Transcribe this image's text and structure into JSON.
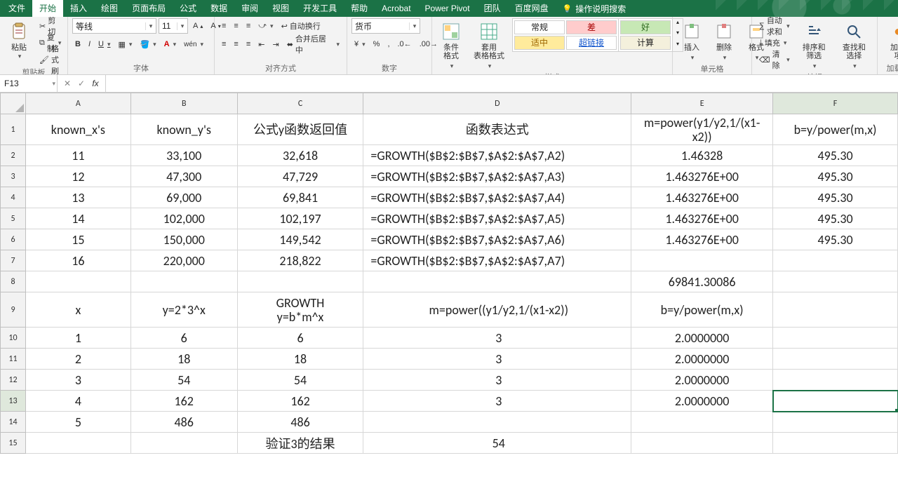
{
  "app": {
    "tabs": [
      "文件",
      "开始",
      "插入",
      "绘图",
      "页面布局",
      "公式",
      "数据",
      "审阅",
      "视图",
      "开发工具",
      "帮助",
      "Acrobat",
      "Power Pivot",
      "团队",
      "百度网盘"
    ],
    "active_tab_index": 1,
    "tell_me": "操作说明搜索"
  },
  "ribbon": {
    "clipboard": {
      "paste": "粘贴",
      "cut": "剪切",
      "copy": "复制",
      "format_painter": "格式刷",
      "group_label": "剪贴板"
    },
    "font": {
      "font_name": "等线",
      "font_size": "11",
      "bold": "B",
      "italic": "I",
      "underline": "U",
      "group_label": "字体"
    },
    "alignment": {
      "wrap": "自动换行",
      "merge": "合并后居中",
      "group_label": "对齐方式"
    },
    "number": {
      "category": "货币",
      "group_label": "数字"
    },
    "styles": {
      "cond_fmt": "条件格式",
      "as_table": "套用\n表格格式",
      "normal": "常规",
      "bad": "差",
      "good": "好",
      "neutral": "适中",
      "link": "超链接",
      "calc": "计算",
      "group_label": "样式"
    },
    "cells": {
      "insert": "插入",
      "delete": "删除",
      "format": "格式",
      "group_label": "单元格"
    },
    "editing": {
      "autosum": "自动求和",
      "fill": "填充",
      "clear": "清除",
      "sort": "排序和筛选",
      "find": "查找和选择",
      "group_label": "编辑"
    },
    "addins": {
      "addins": "加载项",
      "group_label": "加载项"
    }
  },
  "formula_bar": {
    "name_box": "F13",
    "formula": ""
  },
  "grid": {
    "columns": [
      "A",
      "B",
      "C",
      "D",
      "E",
      "F"
    ],
    "headers": {
      "A": "known_x's",
      "B": "known_y's",
      "C": "公式y函数返回值",
      "D": "函数表达式",
      "E": "m=power(y1/y2,1/(x1-x2))",
      "F": "b=y/power(m,x)"
    },
    "rows": [
      {
        "n": 2,
        "A": "11",
        "B": "33,100",
        "C": "32,618",
        "D": "=GROWTH($B$2:$B$7,$A$2:$A$7,A2)",
        "E": "1.46328",
        "F": "495.30"
      },
      {
        "n": 3,
        "A": "12",
        "B": "47,300",
        "C": "47,729",
        "D": "=GROWTH($B$2:$B$7,$A$2:$A$7,A3)",
        "E": "1.463276E+00",
        "F": "495.30"
      },
      {
        "n": 4,
        "A": "13",
        "B": "69,000",
        "C": "69,841",
        "Cred": true,
        "D": "=GROWTH($B$2:$B$7,$A$2:$A$7,A4)",
        "E": "1.463276E+00",
        "F": "495.30"
      },
      {
        "n": 5,
        "A": "14",
        "B": "102,000",
        "C": "102,197",
        "D": "=GROWTH($B$2:$B$7,$A$2:$A$7,A5)",
        "E": "1.463276E+00",
        "F": "495.30"
      },
      {
        "n": 6,
        "A": "15",
        "B": "150,000",
        "C": "149,542",
        "D": "=GROWTH($B$2:$B$7,$A$2:$A$7,A6)",
        "E": "1.463276E+00",
        "F": "495.30"
      },
      {
        "n": 7,
        "A": "16",
        "B": "220,000",
        "C": "218,822",
        "D": "=GROWTH($B$2:$B$7,$A$2:$A$7,A7)",
        "E": "",
        "F": ""
      },
      {
        "n": 8,
        "A": "",
        "B": "",
        "C": "",
        "D": "",
        "E": "69841.30086",
        "Ered": true,
        "F": ""
      },
      {
        "n": 9,
        "A": "x",
        "B": "y=2*3^x",
        "C": "GROWTH\ny=b*m^x",
        "Cmulti": true,
        "D": "m=power((y1/y2,1/(x1-x2))",
        "E": "b=y/power(m,x)",
        "F": ""
      },
      {
        "n": 10,
        "A": "1",
        "B": "6",
        "C": "6",
        "D": "3",
        "E": "2.0000000",
        "F": ""
      },
      {
        "n": 11,
        "A": "2",
        "B": "18",
        "C": "18",
        "D": "3",
        "E": "2.0000000",
        "F": ""
      },
      {
        "n": 12,
        "A": "3",
        "B": "54",
        "C": "54",
        "Cred": true,
        "D": "3",
        "E": "2.0000000",
        "F": ""
      },
      {
        "n": 13,
        "A": "4",
        "B": "162",
        "C": "162",
        "D": "3",
        "E": "2.0000000",
        "F": "",
        "active": "F"
      },
      {
        "n": 14,
        "A": "5",
        "B": "486",
        "C": "486",
        "D": "",
        "E": "",
        "F": ""
      },
      {
        "n": 15,
        "A": "",
        "B": "",
        "C": "验证3的结果",
        "D": "54",
        "Dred": true,
        "E": "",
        "F": ""
      }
    ],
    "col_widths": {
      "A": 150,
      "B": 152,
      "C": 180,
      "D": 382,
      "E": 202,
      "F": 178
    },
    "row_heights": {
      "1": 44,
      "9": 50
    }
  },
  "active_cell": "F13"
}
